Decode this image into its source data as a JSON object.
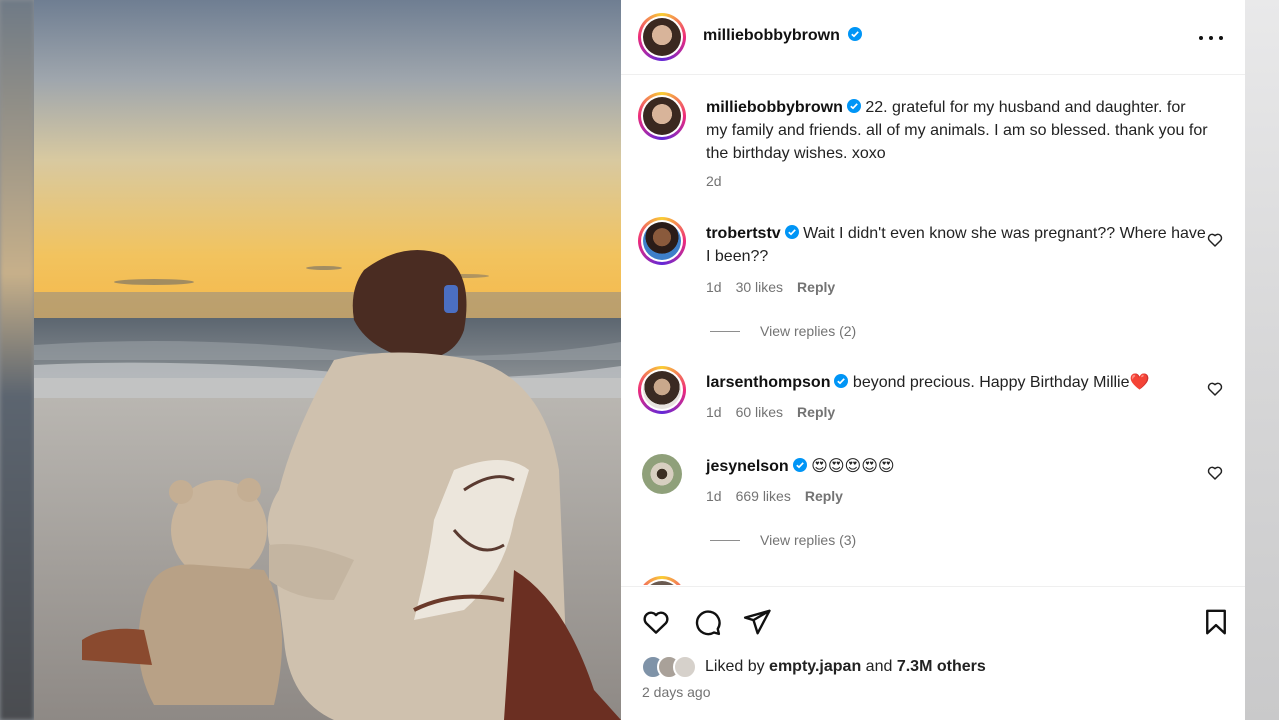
{
  "post": {
    "username": "milliebobbybrown",
    "more_icon": "more-horizontal-icon",
    "caption_text": "22. grateful for my husband and daughter. for my family and friends. all of my animals. I am so blessed. thank you for the birthday wishes. xoxo",
    "caption_time": "2d"
  },
  "comments": [
    {
      "username": "trobertstv",
      "text": "Wait I didn't even know she was pregnant?? Where have I been??",
      "time": "1d",
      "likes": "30 likes",
      "reply": "Reply",
      "view_replies": "View replies (2)"
    },
    {
      "username": "larsenthompson",
      "text": "beyond precious. Happy Birthday Millie❤️",
      "time": "1d",
      "likes": "60 likes",
      "reply": "Reply"
    },
    {
      "username": "jesynelson",
      "text": "😍😍😍😍😍",
      "time": "1d",
      "likes": "669 likes",
      "reply": "Reply",
      "view_replies": "View replies (3)"
    }
  ],
  "actions": {
    "like_icon": "heart-icon",
    "comment_icon": "comment-icon",
    "share_icon": "send-icon",
    "save_icon": "bookmark-icon"
  },
  "likes": {
    "prefix": "Liked by",
    "user": "empty.japan",
    "middle": "and",
    "count": "7.3M others"
  },
  "posted": "2 days ago",
  "colors": {
    "verified": "#0095f6",
    "text_secondary": "#737373",
    "heart_red": "#ed1c24"
  }
}
